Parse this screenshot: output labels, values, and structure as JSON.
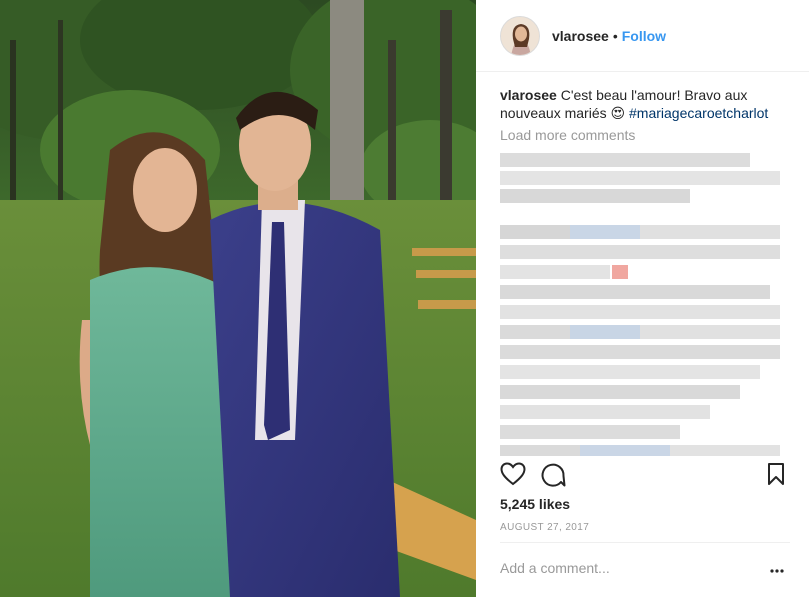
{
  "header": {
    "username": "vlarosee",
    "separator": "•",
    "follow_label": "Follow"
  },
  "caption": {
    "username": "vlarosee",
    "text": "C'est beau l'amour! Bravo aux nouveaux mariés",
    "emoji": "😍",
    "hashtag": "#mariagecaroetcharlot"
  },
  "load_more": "Load more comments",
  "actions": {
    "like_icon": "heart-icon",
    "comment_icon": "comment-icon",
    "save_icon": "bookmark-icon"
  },
  "likes": "5,245 likes",
  "date": "AUGUST 27, 2017",
  "comment_placeholder": "Add a comment...",
  "options_icon": "more-options-icon",
  "colors": {
    "link": "#3897f0",
    "hashtag": "#003569",
    "muted": "#999999",
    "text": "#262626",
    "divider": "#efefef"
  }
}
